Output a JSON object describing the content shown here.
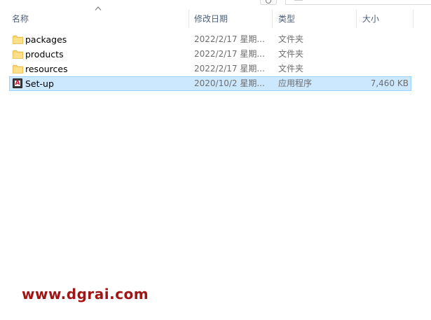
{
  "columns": {
    "name": "名称",
    "date": "修改日期",
    "type": "类型",
    "size": "大小"
  },
  "sort": {
    "column": "name",
    "direction": "ascending",
    "icon": "sort-up-arrow"
  },
  "files": [
    {
      "name": "packages",
      "date": "2022/2/17 星期...",
      "type": "文件夹",
      "size": "",
      "icon": "folder-icon",
      "selected": false
    },
    {
      "name": "products",
      "date": "2022/2/17 星期...",
      "type": "文件夹",
      "size": "",
      "icon": "folder-icon",
      "selected": false
    },
    {
      "name": "resources",
      "date": "2022/2/17 星期...",
      "type": "文件夹",
      "size": "",
      "icon": "folder-icon",
      "selected": false
    },
    {
      "name": "Set-up",
      "date": "2020/10/2 星期...",
      "type": "应用程序",
      "size": "7,460 KB",
      "icon": "adobe-app-icon",
      "selected": true
    }
  ],
  "colors": {
    "selection_fill": "#cce8ff",
    "selection_border": "#99d1ff",
    "header_text": "#4c607a",
    "folder": "#f8d775",
    "watermark": "#a01515"
  },
  "watermark": "www.dgrai.com"
}
